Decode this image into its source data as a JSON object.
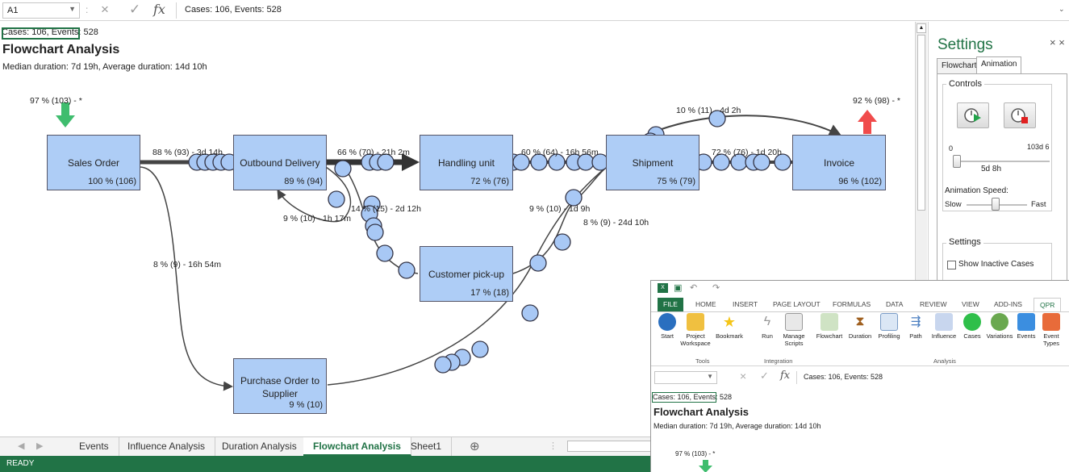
{
  "formula_bar": {
    "name_box": "A1",
    "separator": ":",
    "cancel_icon": "×",
    "enter_icon": "✓",
    "fx": "fx",
    "content": "Cases: 106, Events: 528"
  },
  "sheet": {
    "cell_a1": "Cases: 106, Events: 528",
    "title": "Flowchart Analysis",
    "subtitle": "Median duration: 7d 19h, Average duration: 14d 10h"
  },
  "flowchart": {
    "start_label": "97 % (103) - *",
    "end_label": "92 % (98) - *",
    "nodes": [
      {
        "id": "sales-order",
        "name": "Sales Order",
        "pct": "100 % (106)"
      },
      {
        "id": "outbound-delivery",
        "name": "Outbound Delivery",
        "pct": "89 % (94)"
      },
      {
        "id": "handling-unit",
        "name": "Handling unit",
        "pct": "72 % (76)"
      },
      {
        "id": "shipment",
        "name": "Shipment",
        "pct": "75 % (79)"
      },
      {
        "id": "invoice",
        "name": "Invoice",
        "pct": "96 % (102)"
      },
      {
        "id": "customer-pickup",
        "name": "Customer pick-up",
        "pct": "17 % (18)"
      },
      {
        "id": "purchase-order",
        "name": "Purchase Order to Supplier",
        "pct": "9 % (10)"
      }
    ],
    "edges": [
      {
        "from": "sales-order",
        "to": "outbound-delivery",
        "label": "88 % (93) - 3d 14h"
      },
      {
        "from": "outbound-delivery",
        "to": "handling-unit",
        "label": "66 % (70) - 21h 2m"
      },
      {
        "from": "handling-unit",
        "to": "shipment",
        "label": "60 % (64) - 16h 56m"
      },
      {
        "from": "shipment",
        "to": "invoice",
        "label": "72 % (76) - 1d 20h"
      },
      {
        "from": "handling-unit",
        "to": "invoice",
        "label": "10 % (11) - 4d 2h"
      },
      {
        "from": "outbound-delivery",
        "to": "customer-pickup",
        "label": "14 % (15) - 2d 12h"
      },
      {
        "from": "outbound-delivery",
        "to": "outbound-delivery",
        "label": "9 % (10) - 1h 17m"
      },
      {
        "from": "customer-pickup",
        "to": "invoice",
        "label": "9 % (10) - 1d 9h"
      },
      {
        "from": "purchase-order",
        "to": "invoice",
        "label": "8 % (9) - 24d 10h"
      },
      {
        "from": "sales-order",
        "to": "purchase-order",
        "label": "8 % (9) - 16h 54m"
      }
    ]
  },
  "tabs": {
    "items": [
      "Events",
      "Influence Analysis",
      "Duration Analysis",
      "Flowchart Analysis",
      "Sheet1"
    ],
    "active": "Flowchart Analysis",
    "add": "⊕"
  },
  "status": "READY",
  "settings": {
    "title": "Settings",
    "close": "× ×",
    "tabs": [
      "Flowchart",
      "Animation"
    ],
    "controls_label": "Controls",
    "slider_min": "0",
    "slider_max": "103d 6",
    "slider_value": "5d 8h",
    "speed_label": "Animation Speed:",
    "slow": "Slow",
    "fast": "Fast",
    "settings_label": "Settings",
    "show_inactive": "Show Inactive Cases"
  },
  "inset": {
    "ribbon_tabs": [
      "FILE",
      "HOME",
      "INSERT",
      "PAGE LAYOUT",
      "FORMULAS",
      "DATA",
      "REVIEW",
      "VIEW",
      "ADD-INS",
      "QPR"
    ],
    "buttons": [
      "Start",
      "Project Workspace",
      "Bookmark",
      "Run",
      "Manage Scripts",
      "Flowchart",
      "Duration",
      "Profiling",
      "Path",
      "Influence",
      "Cases",
      "Variations",
      "Events",
      "Event Types"
    ],
    "groups": [
      "Tools",
      "Integration",
      "Analysis"
    ],
    "formula": "Cases: 106, Events: 528",
    "cell_a1": "Cases: 106, Events: 528",
    "title": "Flowchart Analysis",
    "subtitle": "Median duration: 7d 19h, Average duration: 14d 10h",
    "start_label": "97 % (103) - *"
  }
}
